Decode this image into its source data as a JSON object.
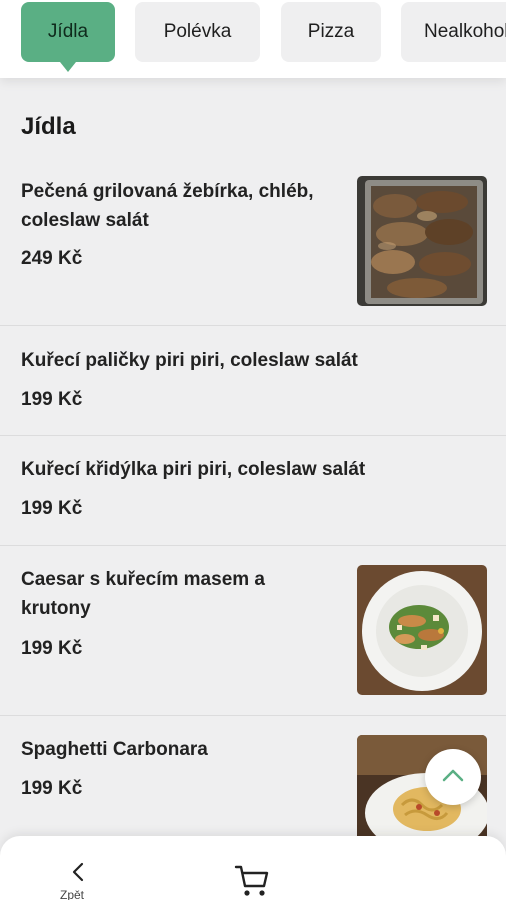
{
  "tabs": [
    {
      "label": "Jídla",
      "active": true
    },
    {
      "label": "Polévka",
      "active": false
    },
    {
      "label": "Pizza",
      "active": false
    },
    {
      "label": "Nealkoholické nápoje",
      "active": false
    }
  ],
  "section": {
    "title": "Jídla"
  },
  "menu_items": [
    {
      "name": "Pečená grilovaná žebírka, chléb, coleslaw salát",
      "price": "249 Kč",
      "has_image": true
    },
    {
      "name": "Kuřecí paličky piri piri, coleslaw salát",
      "price": "199 Kč",
      "has_image": false
    },
    {
      "name": "Kuřecí křidýlka piri piri, coleslaw salát",
      "price": "199 Kč",
      "has_image": false
    },
    {
      "name": "Caesar s kuřecím masem a krutony",
      "price": "199 Kč",
      "has_image": true
    },
    {
      "name": "Spaghetti Carbonara",
      "price": "199 Kč",
      "has_image": true
    }
  ],
  "bottom_bar": {
    "back_label": "Zpět",
    "back_icon": "chevron-left-icon",
    "cart_icon": "cart-icon"
  },
  "scroll_up_icon": "chevron-up-icon",
  "colors": {
    "accent": "#5aaf84",
    "background": "#efeff0",
    "surface": "#ffffff"
  }
}
